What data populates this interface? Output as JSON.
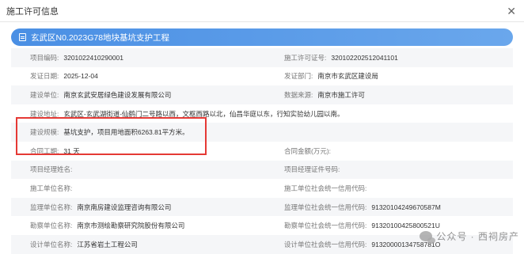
{
  "dialog": {
    "title": "施工许可信息",
    "close": "✕"
  },
  "project": {
    "name": "玄武区N0.2023G78地块基坑支护工程"
  },
  "rows": [
    {
      "l_label": "项目编码:",
      "l_value": "3201022410290001",
      "r_label": "施工许可证号:",
      "r_value": "320102202512041101"
    },
    {
      "l_label": "发证日期:",
      "l_value": "2025-12-04",
      "r_label": "发证部门:",
      "r_value": "南京市玄武区建设局"
    },
    {
      "l_label": "建设单位:",
      "l_value": "南京玄武安居绿色建设发展有限公司",
      "r_label": "数据来源:",
      "r_value": "南京市施工许可"
    },
    {
      "full_label": "建设地址:",
      "full_value": "玄武区-玄武湖街道-仙鹤门二号路以西，文枢西路以北，仙昌华庭以东，行知实验幼儿园以南。"
    },
    {
      "full_label": "建设规模:",
      "full_value": "基坑支护，项目用地面积6263.81平方米。"
    },
    {
      "l_label": "合同工期:",
      "l_value": "31 天",
      "r_label": "合同金额(万元):",
      "r_value": ""
    },
    {
      "l_label": "项目经理姓名:",
      "l_value": "",
      "r_label": "项目经理证件号码:",
      "r_value": ""
    },
    {
      "l_label": "施工单位名称:",
      "l_value": "",
      "r_label": "施工单位社会统一信用代码:",
      "r_value": ""
    },
    {
      "l_label": "监理单位名称:",
      "l_value": "南京南房建设监理咨询有限公司",
      "r_label": "监理单位社会统一信用代码:",
      "r_value": "91320104249670587M"
    },
    {
      "l_label": "勘察单位名称:",
      "l_value": "南京市测绘勘察研究院股份有限公司",
      "r_label": "勘察单位社会统一信用代码:",
      "r_value": "91320100425800521U"
    },
    {
      "l_label": "设计单位名称:",
      "l_value": "江苏省岩土工程公司",
      "r_label": "设计单位社会统一信用代码:",
      "r_value": "91320000134758781O"
    }
  ],
  "watermark": "公众号 · 西祠房产"
}
